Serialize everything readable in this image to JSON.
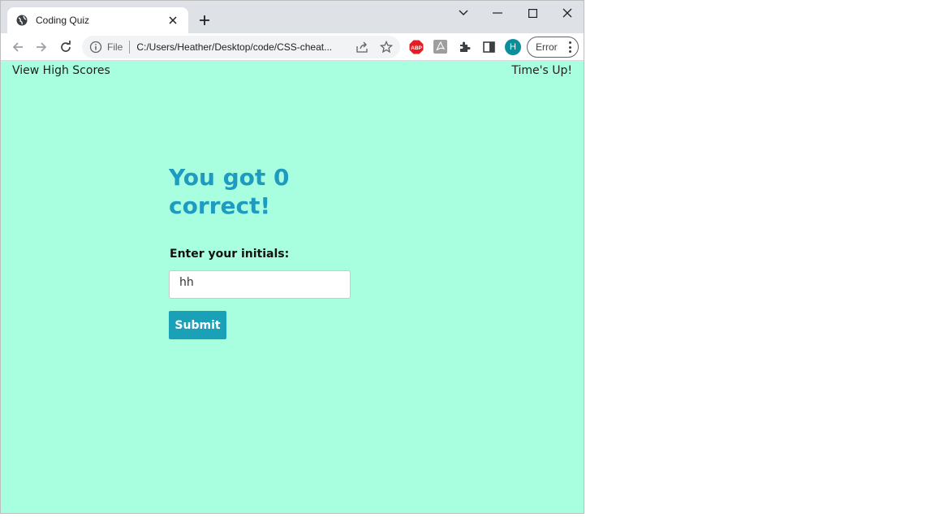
{
  "browser": {
    "tab_title": "Coding Quiz",
    "scheme_label": "File",
    "url": "C:/Users/Heather/Desktop/code/CSS-cheat...",
    "profile_initial": "H",
    "error_label": "Error"
  },
  "page": {
    "header": {
      "view_high_scores": "View High Scores",
      "timer_text": "Time's Up!"
    },
    "result_text": "You got 0 correct!",
    "initials_label": "Enter your initials:",
    "initials_value": "hh",
    "submit_label": "Submit"
  },
  "colors": {
    "page_background": "#a7ffe0",
    "heading": "#1e9bbf",
    "button": "#1aa1b8"
  }
}
